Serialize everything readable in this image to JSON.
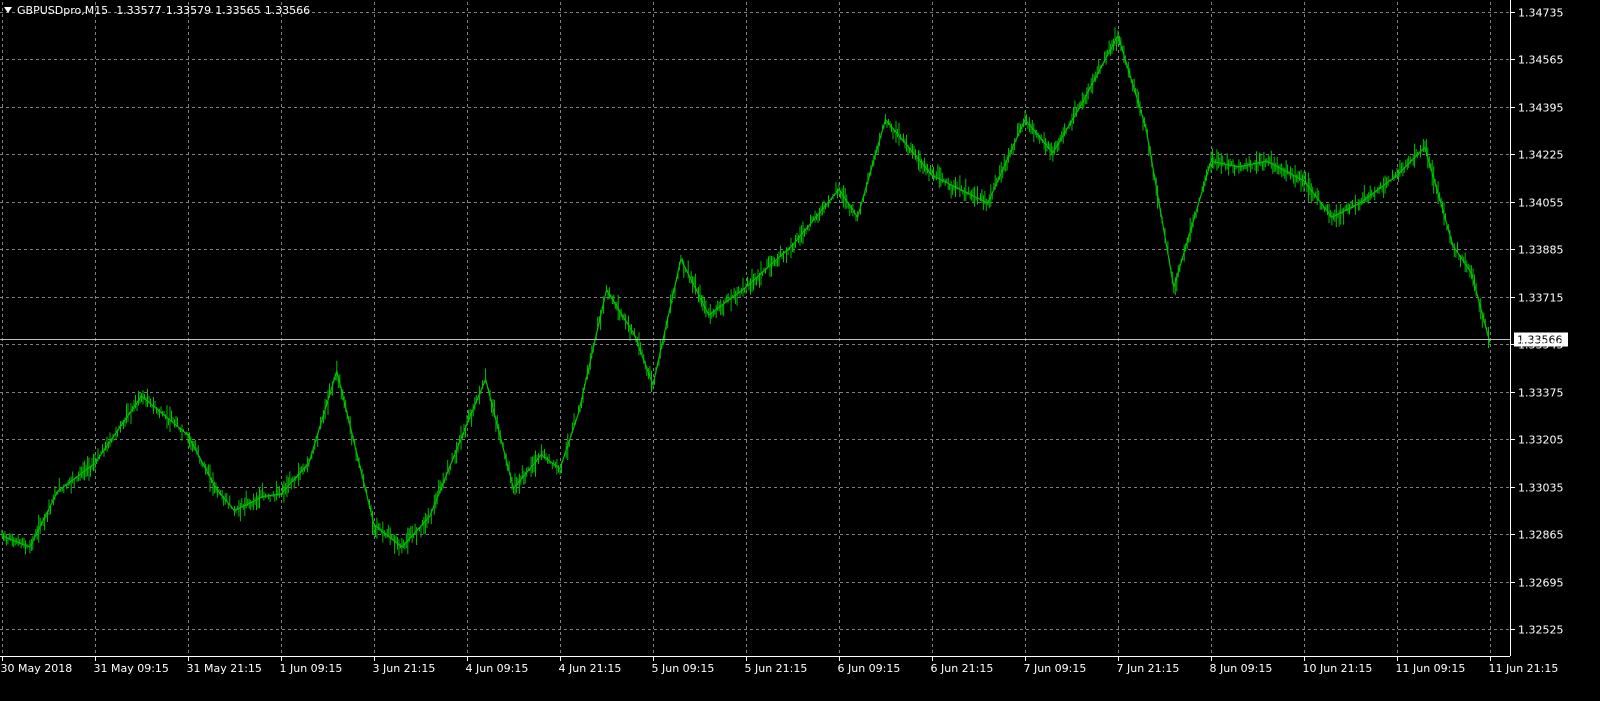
{
  "window": {
    "symbol_label": "GBPUSDpro,M15",
    "prices": [
      "1.33577",
      "1.33579",
      "1.33565",
      "1.33566"
    ]
  },
  "colors": {
    "background": "#000000",
    "grid": "#7f7f7f",
    "price_line": "#00c000",
    "axis_text": "#ffffff",
    "current_price_line": "#c0c0c0"
  },
  "icons": {
    "menu": "triangle-down-icon"
  },
  "chart_data": {
    "type": "line",
    "title": "",
    "xlabel": "",
    "ylabel": "",
    "grid": true,
    "legend": "none",
    "ylim": [
      1.3243,
      1.3477
    ],
    "y_ticks": [
      "1.34735",
      "1.34565",
      "1.34395",
      "1.34225",
      "1.34055",
      "1.33885",
      "1.33715",
      "1.33545",
      "1.33375",
      "1.33205",
      "1.33035",
      "1.32865",
      "1.32695",
      "1.32525"
    ],
    "x_ticks": [
      "30 May 2018",
      "31 May 09:15",
      "31 May 21:15",
      "1 Jun 09:15",
      "3 Jun 21:15",
      "4 Jun 09:15",
      "4 Jun 21:15",
      "5 Jun 09:15",
      "5 Jun 21:15",
      "6 Jun 09:15",
      "6 Jun 21:15",
      "7 Jun 09:15",
      "7 Jun 21:15",
      "8 Jun 09:15",
      "10 Jun 21:15",
      "11 Jun 09:15",
      "11 Jun 21:15"
    ],
    "current_price": 1.33566,
    "current_price_label": "1.33566",
    "series": [
      {
        "x": [
          0,
          0.3,
          0.6,
          1,
          1.5,
          2,
          2.3,
          2.5,
          2.8,
          3,
          3.3,
          3.6,
          4,
          4.3,
          4.6,
          5,
          5.2,
          5.5,
          5.8,
          6,
          6.2,
          6.5,
          6.8,
          7,
          7.3,
          7.6,
          8,
          8.5,
          9,
          9.2,
          9.5,
          10,
          10.3,
          10.6,
          11,
          11.3,
          11.6,
          12,
          12.3,
          12.6,
          13,
          13.3,
          13.6,
          14,
          14.3,
          14.6,
          15,
          15.3,
          15.6,
          15.8,
          16
        ],
        "y": [
          1.3286,
          1.3282,
          1.3302,
          1.3312,
          1.3336,
          1.3322,
          1.3303,
          1.3295,
          1.33,
          1.3301,
          1.3312,
          1.3345,
          1.329,
          1.3282,
          1.3293,
          1.3326,
          1.3342,
          1.3303,
          1.3315,
          1.331,
          1.333,
          1.3374,
          1.3358,
          1.334,
          1.3385,
          1.3365,
          1.3375,
          1.339,
          1.341,
          1.34,
          1.3435,
          1.3415,
          1.341,
          1.3405,
          1.3435,
          1.3423,
          1.344,
          1.3465,
          1.3432,
          1.3375,
          1.342,
          1.3418,
          1.342,
          1.3413,
          1.34,
          1.3405,
          1.3415,
          1.3425,
          1.339,
          1.338,
          1.3355
        ]
      }
    ]
  }
}
